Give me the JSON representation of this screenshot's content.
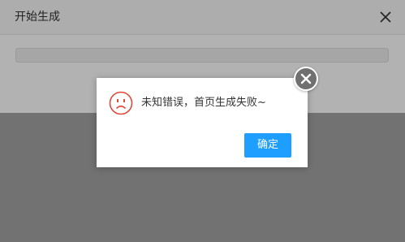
{
  "base_dialog": {
    "title": "开始生成",
    "close_icon": "close-icon"
  },
  "alert": {
    "icon": "sad-face-icon",
    "message": "未知错误，首页生成失败~",
    "confirm_label": "确定",
    "close_icon": "close-circle-icon"
  },
  "colors": {
    "button": "#1e9fff",
    "icon_red": "#e0483a",
    "overlay": "rgba(0,0,0,0.30)"
  }
}
